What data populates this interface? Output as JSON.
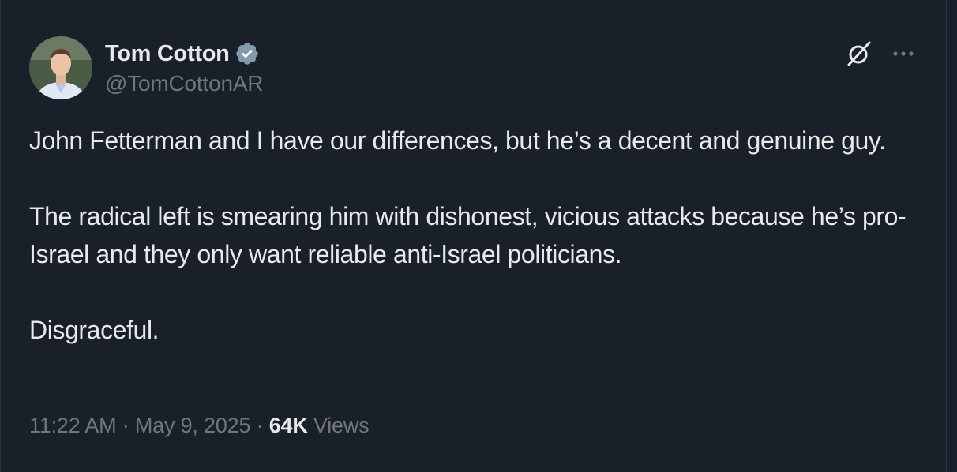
{
  "author": {
    "display_name": "Tom Cotton",
    "handle": "@TomCottonAR",
    "verified_icon": "verified-badge-icon",
    "avatar": "profile-photo"
  },
  "header_actions": {
    "grok_icon": "grok-icon",
    "more_icon": "more-options-icon"
  },
  "tweet": {
    "paragraphs": [
      "John Fetterman and I have our differences, but he’s a decent and genuine guy.",
      "The radical left is smearing him with dishonest, vicious attacks because he’s pro-Israel and they only want reliable anti-Israel politicians.",
      "Disgraceful."
    ]
  },
  "meta": {
    "time": "11:22 AM",
    "separator": " · ",
    "date": "May 9, 2025",
    "views_count": "64K",
    "views_label": " Views"
  },
  "colors": {
    "background": "#1a202a",
    "text_primary": "#e7e9ea",
    "text_secondary": "#71767b",
    "verified": "#829aab"
  }
}
